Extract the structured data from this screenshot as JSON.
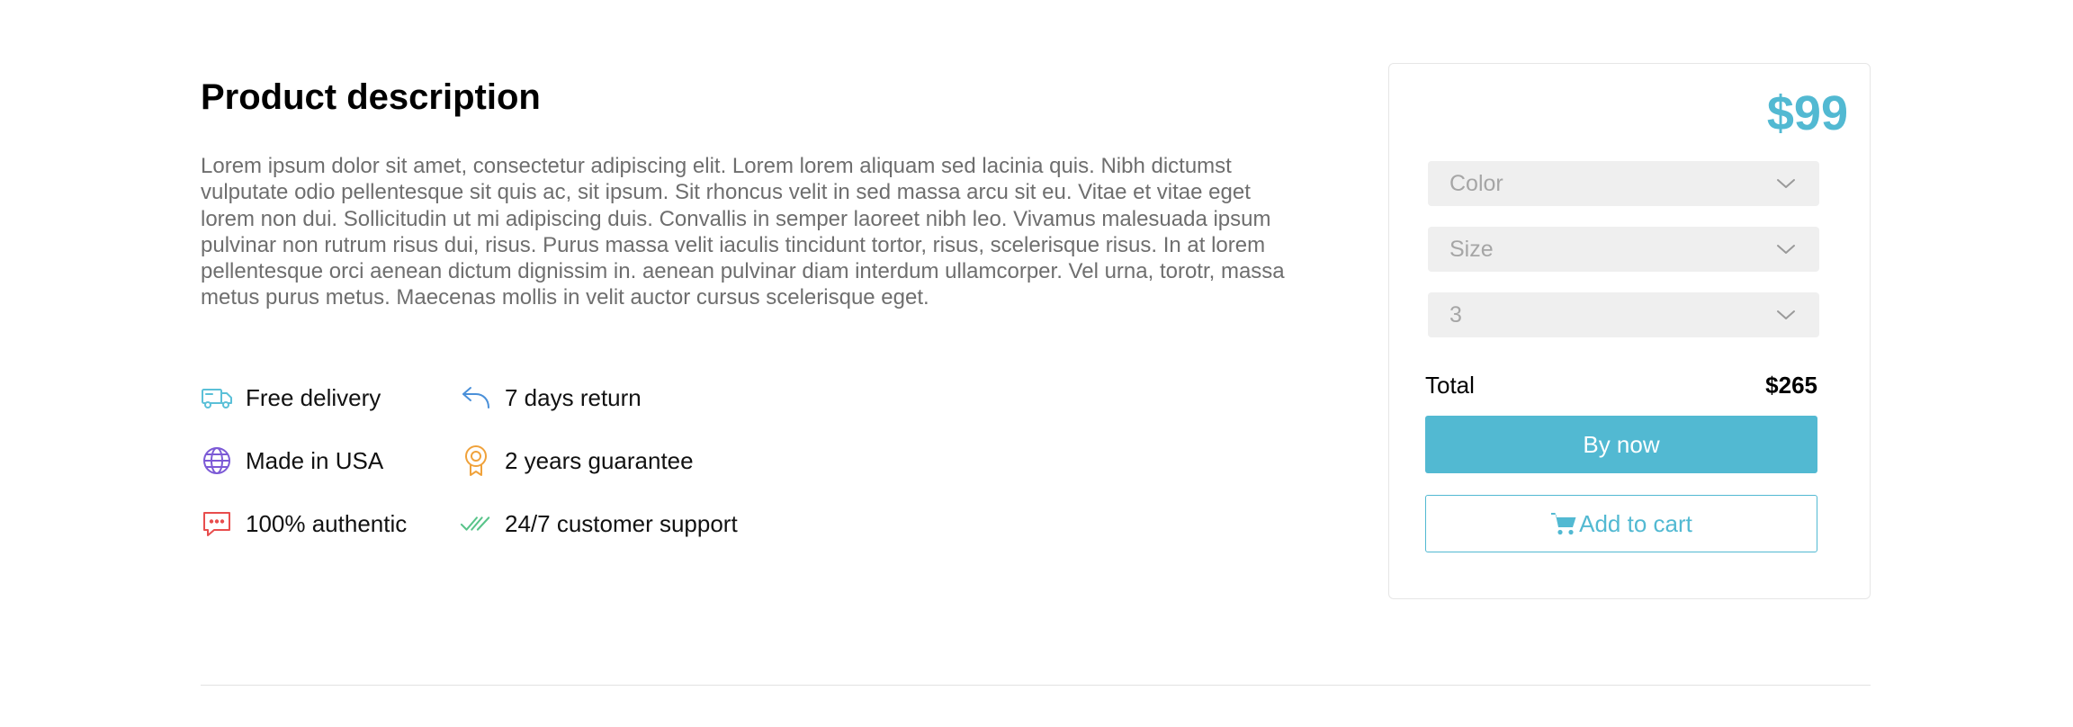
{
  "product": {
    "title": "Product description",
    "description": "Lorem ipsum dolor sit amet, consectetur adipiscing elit. Lorem lorem aliquam sed lacinia quis. Nibh dictumst vulputate odio pellentesque sit quis ac, sit ipsum. Sit rhoncus velit in sed massa arcu sit eu. Vitae et vitae eget lorem non dui. Sollicitudin ut mi adipiscing duis. Convallis in semper laoreet nibh leo. Vivamus malesuada ipsum pulvinar non rutrum risus dui, risus. Purus massa velit iaculis tincidunt tortor, risus, scelerisque risus. In at lorem pellentesque orci aenean dictum dignissim in. aenean pulvinar diam interdum ullamcorper. Vel urna, torotr, massa metus purus metus. Maecenas mollis in velit auctor cursus scelerisque eget."
  },
  "features": [
    {
      "label": "Free delivery",
      "icon": "truck-icon",
      "color": "#5bc0d8"
    },
    {
      "label": "7 days return",
      "icon": "return-arrow-icon",
      "color": "#4a90d9"
    },
    {
      "label": "Made in USA",
      "icon": "globe-icon",
      "color": "#7c5ad6"
    },
    {
      "label": "2 years guarantee",
      "icon": "award-badge-icon",
      "color": "#f0a23b"
    },
    {
      "label": "100% authentic",
      "icon": "chat-bubble-icon",
      "color": "#e84d4d"
    },
    {
      "label": "24/7 customer support",
      "icon": "double-check-icon",
      "color": "#59c48a"
    }
  ],
  "purchase": {
    "price": "$99",
    "selects": {
      "color": "Color",
      "size": "Size",
      "quantity": "3"
    },
    "total_label": "Total",
    "total_value": "$265",
    "buy_label": "By now",
    "cart_label": "Add to cart"
  },
  "colors": {
    "accent": "#52b9d2",
    "text_muted": "#6e6e6e",
    "select_bg": "#efefef"
  }
}
